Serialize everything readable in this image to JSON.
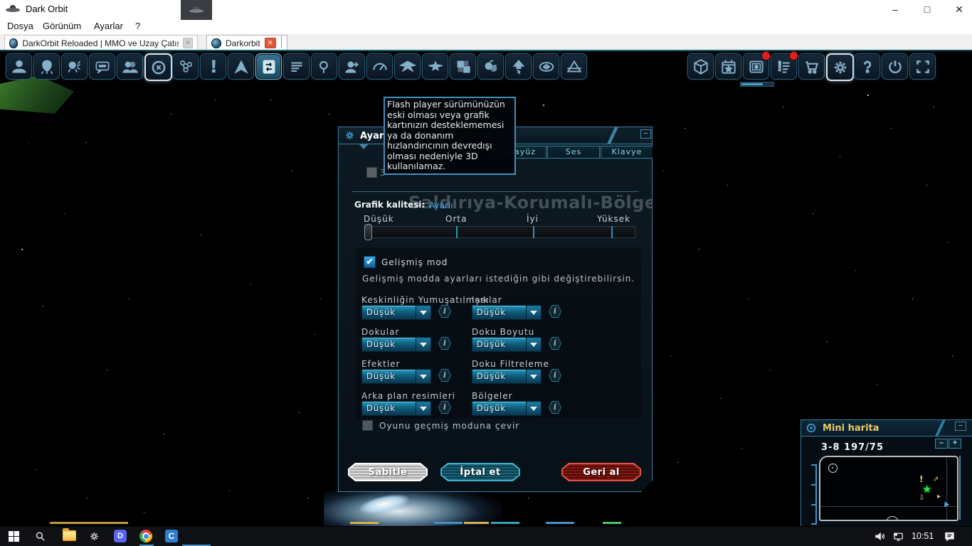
{
  "window": {
    "title": "Dark Orbit",
    "controls": {
      "minimize": "–",
      "maximize": "□",
      "close": "✕"
    }
  },
  "menu_bar": {
    "items": [
      "Dosya",
      "Görünüm",
      "Ayarlar",
      "?"
    ]
  },
  "tab_bar": {
    "tabs": [
      {
        "label": "DarkOrbit Reloaded | MMO ve Uzay Çatışması",
        "active": false
      },
      {
        "label": "Darkorbit",
        "active": true
      }
    ]
  },
  "toolbar": {
    "left_icons": [
      {
        "name": "pilot"
      },
      {
        "name": "alien"
      },
      {
        "name": "alien-swarm"
      },
      {
        "name": "chat"
      },
      {
        "name": "friends"
      },
      {
        "name": "circle-x",
        "state": "focused"
      },
      {
        "name": "node-web"
      },
      {
        "name": "exclaim"
      },
      {
        "name": "ship-up"
      },
      {
        "name": "doc-transfer",
        "state": "active"
      },
      {
        "name": "menu-lines"
      },
      {
        "name": "magnify"
      },
      {
        "name": "person-add"
      },
      {
        "name": "gauge"
      },
      {
        "name": "bat-wings"
      },
      {
        "name": "wing-star"
      },
      {
        "name": "blocks"
      },
      {
        "name": "berries"
      },
      {
        "name": "upgrade-bolt"
      },
      {
        "name": "eye-oval"
      },
      {
        "name": "prism"
      }
    ],
    "right_icons": [
      {
        "name": "package"
      },
      {
        "name": "calendar-star"
      },
      {
        "name": "vault",
        "badge": true
      },
      {
        "name": "list-alert",
        "badge": true
      },
      {
        "name": "cart"
      },
      {
        "name": "gear",
        "state": "focused"
      },
      {
        "name": "question"
      },
      {
        "name": "power"
      },
      {
        "name": "fullscreen"
      }
    ]
  },
  "game": {
    "map_watermark": "Saldırıya-Korumalı-Bölge"
  },
  "tooltip": "Flash player sürümünüzün eski olması veya grafik kartınızın desteklememesi ya da donanım hızlandırıcının devredışı olması nedeniyle 3D kullanılamaz.",
  "dialog": {
    "title": "Ayarlar",
    "minimize_label": "–",
    "tabs": [
      {
        "label": "Arayüz"
      },
      {
        "label": "Ses"
      },
      {
        "label": "Klavye"
      }
    ],
    "disabled_checkbox_visible_text": "3",
    "graphics_quality_label": "Grafik kalitesi:",
    "graphics_quality_value": "Ayarlı",
    "slider_labels": [
      "Düşük",
      "Orta",
      "İyi",
      "Yüksek"
    ],
    "advanced": {
      "checkbox_label": "Gelişmiş mod",
      "checkbox_checked": true,
      "check_glyph": "✔",
      "description": "Gelişmiş modda ayarları istediğin gibi değiştirebilirsin.",
      "dropdowns": [
        {
          "label": "Keskinliğin Yumuşatılması",
          "value": "Düşük"
        },
        {
          "label": "Işıklar",
          "value": "Düşük"
        },
        {
          "label": "Dokular",
          "value": "Düşük"
        },
        {
          "label": "Doku Boyutu",
          "value": "Düşük"
        },
        {
          "label": "Efektler",
          "value": "Düşük"
        },
        {
          "label": "Doku Filtreleme",
          "value": "Düşük"
        },
        {
          "label": "Arka plan resimleri",
          "value": "Düşük"
        },
        {
          "label": "Bölgeler",
          "value": "Düşük"
        }
      ],
      "legacy_checkbox_label": "Oyunu geçmiş moduna çevir"
    },
    "buttons": {
      "pin": "Sabitle",
      "cancel": "İptal et",
      "revert": "Geri al"
    }
  },
  "minimap": {
    "title": "Mini harita",
    "minimize_label": "–",
    "zoom_out": "–",
    "zoom_in": "+",
    "map_id": "3-8",
    "position": "197/75",
    "alert_glyph": "!",
    "player_star_glyph": "★"
  },
  "taskbar": {
    "time": "10:51",
    "capp_letter": "C",
    "discord_letter": "D"
  }
}
